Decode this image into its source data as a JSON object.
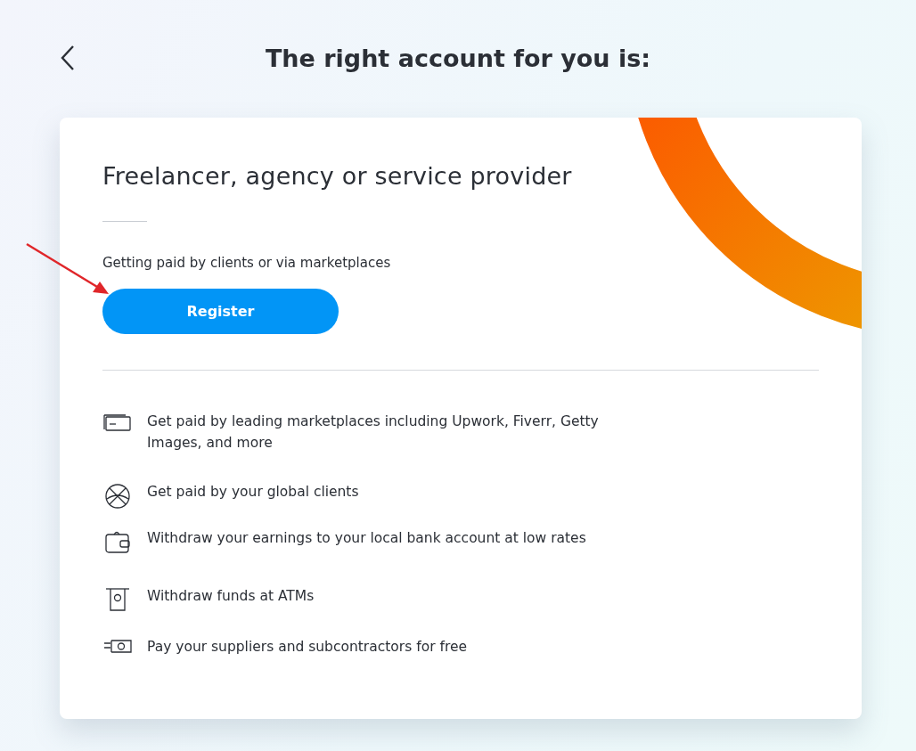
{
  "header": {
    "title": "The right account for you is:"
  },
  "card": {
    "title": "Freelancer, agency or service provider",
    "subtitle": "Getting paid by clients or via marketplaces",
    "button": "Register",
    "features": [
      {
        "kind": "card",
        "text": "Get paid by leading marketplaces including Upwork, Fiverr, Getty Images, and more"
      },
      {
        "kind": "globe",
        "text": "Get paid by your global clients"
      },
      {
        "kind": "wallet",
        "text": "Withdraw your earnings to your local bank account at low rates"
      },
      {
        "kind": "atm",
        "text": "Withdraw funds at ATMs"
      },
      {
        "kind": "cash",
        "text": "Pay your suppliers and subcontractors for free"
      }
    ]
  }
}
